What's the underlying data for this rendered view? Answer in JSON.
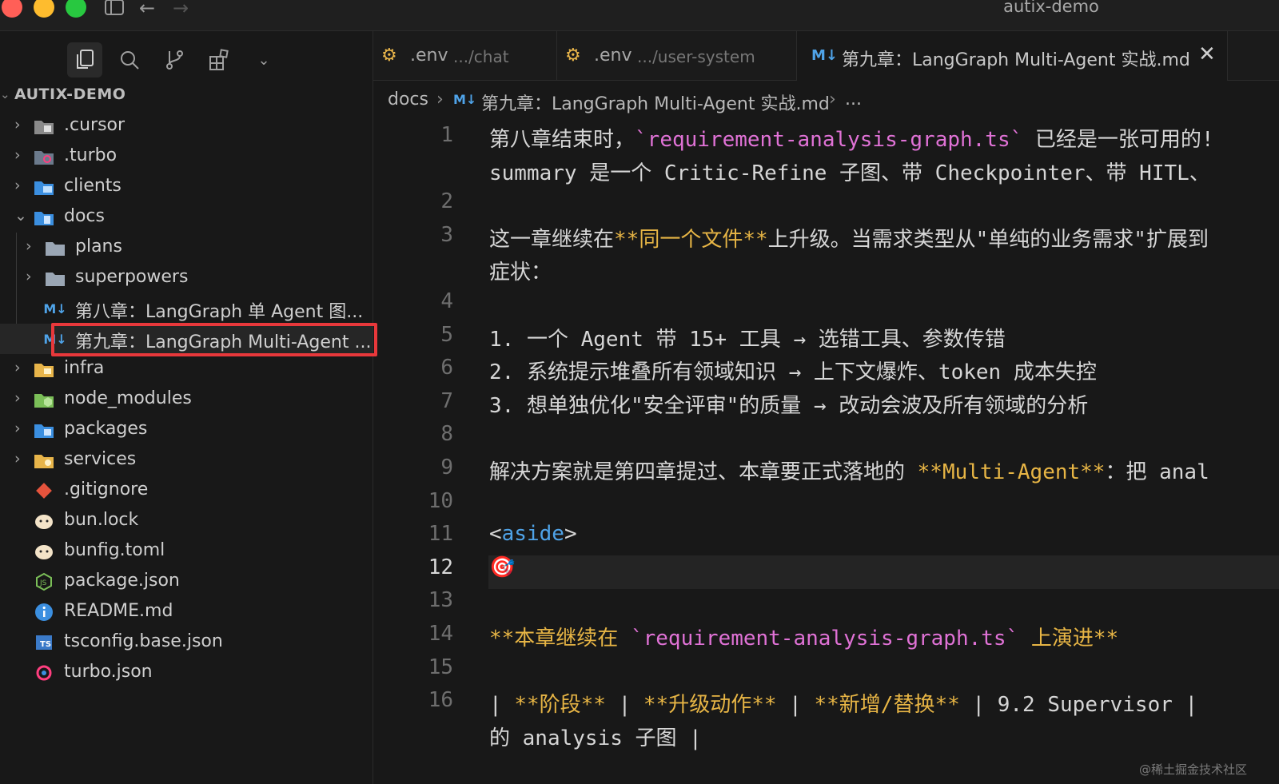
{
  "window": {
    "title": "autix-demo",
    "traffic_lights": [
      "#ff5f57",
      "#febc2e",
      "#28c840"
    ]
  },
  "sidebar": {
    "explorer_title": "AUTIX-DEMO",
    "tree": [
      {
        "label": ".cursor",
        "icon": "folder-cursor-icon"
      },
      {
        "label": ".turbo",
        "icon": "folder-turbo-icon"
      },
      {
        "label": "clients",
        "icon": "folder-clients-icon"
      },
      {
        "label": "docs",
        "icon": "folder-docs-icon",
        "expanded": true
      },
      {
        "label": "plans",
        "icon": "folder-icon"
      },
      {
        "label": "superpowers",
        "icon": "folder-icon"
      },
      {
        "label": "第八章：LangGraph 单 Agent 图...",
        "icon": "markdown-icon"
      },
      {
        "label": "第九章：LangGraph Multi-Agent ...",
        "icon": "markdown-icon",
        "selected": true
      },
      {
        "label": "infra",
        "icon": "folder-infra-icon"
      },
      {
        "label": "node_modules",
        "icon": "folder-node-icon"
      },
      {
        "label": "packages",
        "icon": "folder-packages-icon"
      },
      {
        "label": "services",
        "icon": "folder-services-icon"
      },
      {
        "label": ".gitignore",
        "icon": "git-icon"
      },
      {
        "label": "bun.lock",
        "icon": "bun-icon"
      },
      {
        "label": "bunfig.toml",
        "icon": "bun-icon"
      },
      {
        "label": "package.json",
        "icon": "nodejs-icon"
      },
      {
        "label": "README.md",
        "icon": "info-icon"
      },
      {
        "label": "tsconfig.base.json",
        "icon": "typescript-icon"
      },
      {
        "label": "turbo.json",
        "icon": "turbo-icon"
      }
    ]
  },
  "tabs": [
    {
      "name": ".env",
      "path": ".../chat"
    },
    {
      "name": ".env",
      "path": ".../user-system"
    },
    {
      "name": "第九章：LangGraph Multi-Agent 实战.md",
      "path": "",
      "active": true
    }
  ],
  "breadcrumb": {
    "folder": "docs",
    "file": "第九章：LangGraph Multi-Agent 实战.md",
    "more": "..."
  },
  "editor": {
    "current_line": 12,
    "lines": [
      {
        "n": "1",
        "segments": [
          {
            "t": "第八章结束时，"
          },
          {
            "t": "`requirement-analysis-graph.ts`",
            "c": "pink"
          },
          {
            "t": " 已经是一张可用的!"
          }
        ]
      },
      {
        "n": "",
        "segments": [
          {
            "t": "summary 是一个 Critic-Refine 子图、带 Checkpointer、带 HITL、"
          }
        ]
      },
      {
        "n": "2",
        "segments": []
      },
      {
        "n": "3",
        "segments": [
          {
            "t": "这一章继续在"
          },
          {
            "t": "**同一个文件**",
            "c": "yellow"
          },
          {
            "t": "上升级。当需求类型从\"单纯的业务需求\"扩展到"
          }
        ]
      },
      {
        "n": "",
        "segments": [
          {
            "t": "症状："
          }
        ]
      },
      {
        "n": "4",
        "segments": []
      },
      {
        "n": "5",
        "segments": [
          {
            "t": "1. 一个 Agent 带 15+ 工具 → 选错工具、参数传错"
          }
        ]
      },
      {
        "n": "6",
        "segments": [
          {
            "t": "2. 系统提示堆叠所有领域知识 → 上下文爆炸、token 成本失控"
          }
        ]
      },
      {
        "n": "7",
        "segments": [
          {
            "t": "3. 想单独优化\"安全评审\"的质量 → 改动会波及所有领域的分析"
          }
        ]
      },
      {
        "n": "8",
        "segments": []
      },
      {
        "n": "9",
        "segments": [
          {
            "t": "解决方案就是第四章提过、本章要正式落地的 "
          },
          {
            "t": "**Multi-Agent**",
            "c": "yellow"
          },
          {
            "t": "：把 anal"
          }
        ]
      },
      {
        "n": "10",
        "segments": []
      },
      {
        "n": "11",
        "segments": [
          {
            "t": "<"
          },
          {
            "t": "aside",
            "c": "blue"
          },
          {
            "t": ">"
          }
        ]
      },
      {
        "n": "12",
        "segments": [
          {
            "t": "🎯"
          }
        ]
      },
      {
        "n": "13",
        "segments": []
      },
      {
        "n": "14",
        "segments": [
          {
            "t": "**本章继续在 ",
            "c": "yellow"
          },
          {
            "t": "`requirement-analysis-graph.ts`",
            "c": "pink"
          },
          {
            "t": " 上演进**",
            "c": "yellow"
          }
        ]
      },
      {
        "n": "15",
        "segments": []
      },
      {
        "n": "16",
        "segments": [
          {
            "t": "| "
          },
          {
            "t": "**阶段**",
            "c": "yellow"
          },
          {
            "t": " | "
          },
          {
            "t": "**升级动作**",
            "c": "yellow"
          },
          {
            "t": " | "
          },
          {
            "t": "**新增/替换**",
            "c": "yellow"
          },
          {
            "t": " | 9.2 Supervisor |"
          }
        ]
      },
      {
        "n": "",
        "segments": [
          {
            "t": "的 analysis 子图 |"
          }
        ]
      }
    ]
  },
  "watermark": "@稀土掘金技术社区"
}
